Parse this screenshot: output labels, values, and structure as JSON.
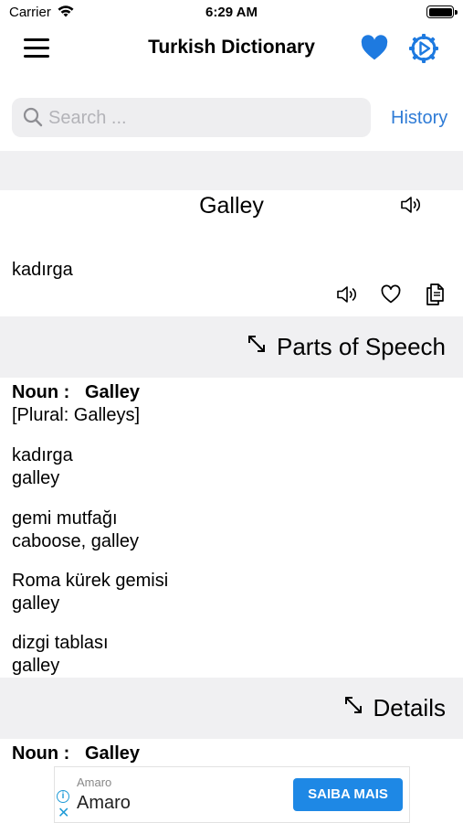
{
  "status_bar": {
    "carrier": "Carrier",
    "time": "6:29 AM"
  },
  "nav": {
    "title": "Turkish Dictionary",
    "menu_icon": "hamburger-icon",
    "favorite_icon": "heart-icon",
    "settings_icon": "gear-icon"
  },
  "search": {
    "placeholder": "Search ...",
    "history_label": "History"
  },
  "entry": {
    "word": "Galley",
    "translation": "kadırga"
  },
  "sections": {
    "parts_of_speech": "Parts of Speech",
    "details": "Details"
  },
  "parts_of_speech": {
    "label": "Noun :",
    "word": "Galley",
    "plural": "[Plural: Galleys]",
    "meanings": [
      {
        "turkish": "kadırga",
        "english": "galley"
      },
      {
        "turkish": "gemi mutfağı",
        "english": "caboose, galley"
      },
      {
        "turkish": "Roma kürek gemisi",
        "english": "galley"
      },
      {
        "turkish": "dizgi tablası",
        "english": "galley"
      }
    ]
  },
  "details": {
    "label": "Noun :",
    "word": "Galley"
  },
  "ad": {
    "small_title": "Amaro",
    "title": "Amaro",
    "button": "SAIBA MAIS"
  },
  "colors": {
    "accent": "#2e7bd6",
    "heart": "#1e7ae0",
    "band": "#f0f0f2",
    "ad_button": "#1e88e5"
  }
}
